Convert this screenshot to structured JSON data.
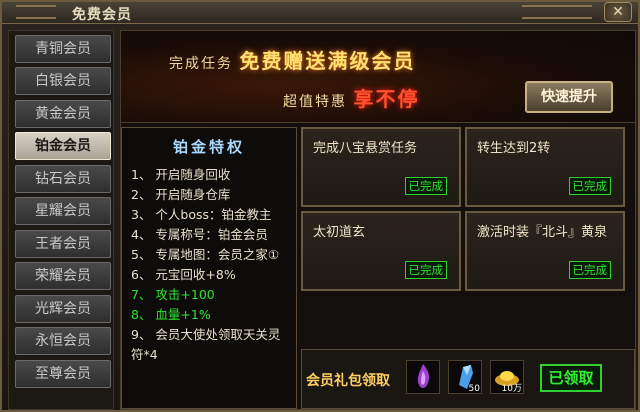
{
  "window": {
    "title": "免费会员",
    "close_label": "✕"
  },
  "sidebar": {
    "items": [
      {
        "label": "青铜会员",
        "active": false
      },
      {
        "label": "白银会员",
        "active": false
      },
      {
        "label": "黄金会员",
        "active": false
      },
      {
        "label": "铂金会员",
        "active": true
      },
      {
        "label": "钻石会员",
        "active": false
      },
      {
        "label": "星耀会员",
        "active": false
      },
      {
        "label": "王者会员",
        "active": false
      },
      {
        "label": "荣耀会员",
        "active": false
      },
      {
        "label": "光辉会员",
        "active": false
      },
      {
        "label": "永恒会员",
        "active": false
      },
      {
        "label": "至尊会员",
        "active": false
      }
    ]
  },
  "banner": {
    "line1_prefix": "完成任务",
    "line1_highlight": "免费赠送满级会员",
    "line2_prefix": "超值特惠",
    "line2_highlight": "享不停",
    "quick_button": "快速提升"
  },
  "privileges": {
    "title": "铂金特权",
    "items": [
      {
        "text": "1、 开启随身回收",
        "green": false
      },
      {
        "text": "2、 开启随身仓库",
        "green": false
      },
      {
        "text": "3、 个人boss：铂金教主",
        "green": false
      },
      {
        "text": "4、 专属称号：铂金会员",
        "green": false
      },
      {
        "text": "5、 专属地图：会员之家①",
        "green": false
      },
      {
        "text": "6、 元宝回收+8%",
        "green": false
      },
      {
        "text": "7、 攻击+100",
        "green": true
      },
      {
        "text": "8、 血量+1%",
        "green": true
      },
      {
        "text": "9、 会员大使处领取天关灵",
        "green": false
      },
      {
        "text": "符*4",
        "green": false
      }
    ]
  },
  "tasks": [
    {
      "label": "完成八宝悬赏任务",
      "status": "已完成"
    },
    {
      "label": "转生达到2转",
      "status": "已完成"
    },
    {
      "label": "太初道玄",
      "status": "已完成"
    },
    {
      "label": "激活时装『北斗』黄泉",
      "status": "已完成"
    }
  ],
  "gift": {
    "label": "会员礼包领取",
    "slots": [
      {
        "icon": "purple-flame-icon",
        "count": ""
      },
      {
        "icon": "blue-crystal-icon",
        "count": "50"
      },
      {
        "icon": "gold-ingot-icon",
        "count": "10万"
      }
    ],
    "claim_button": "已领取"
  },
  "colors": {
    "accent_gold": "#ffd060",
    "done_green": "#30e030",
    "highlight_red": "#ff5030",
    "privilege_title": "#a8d8ff"
  }
}
